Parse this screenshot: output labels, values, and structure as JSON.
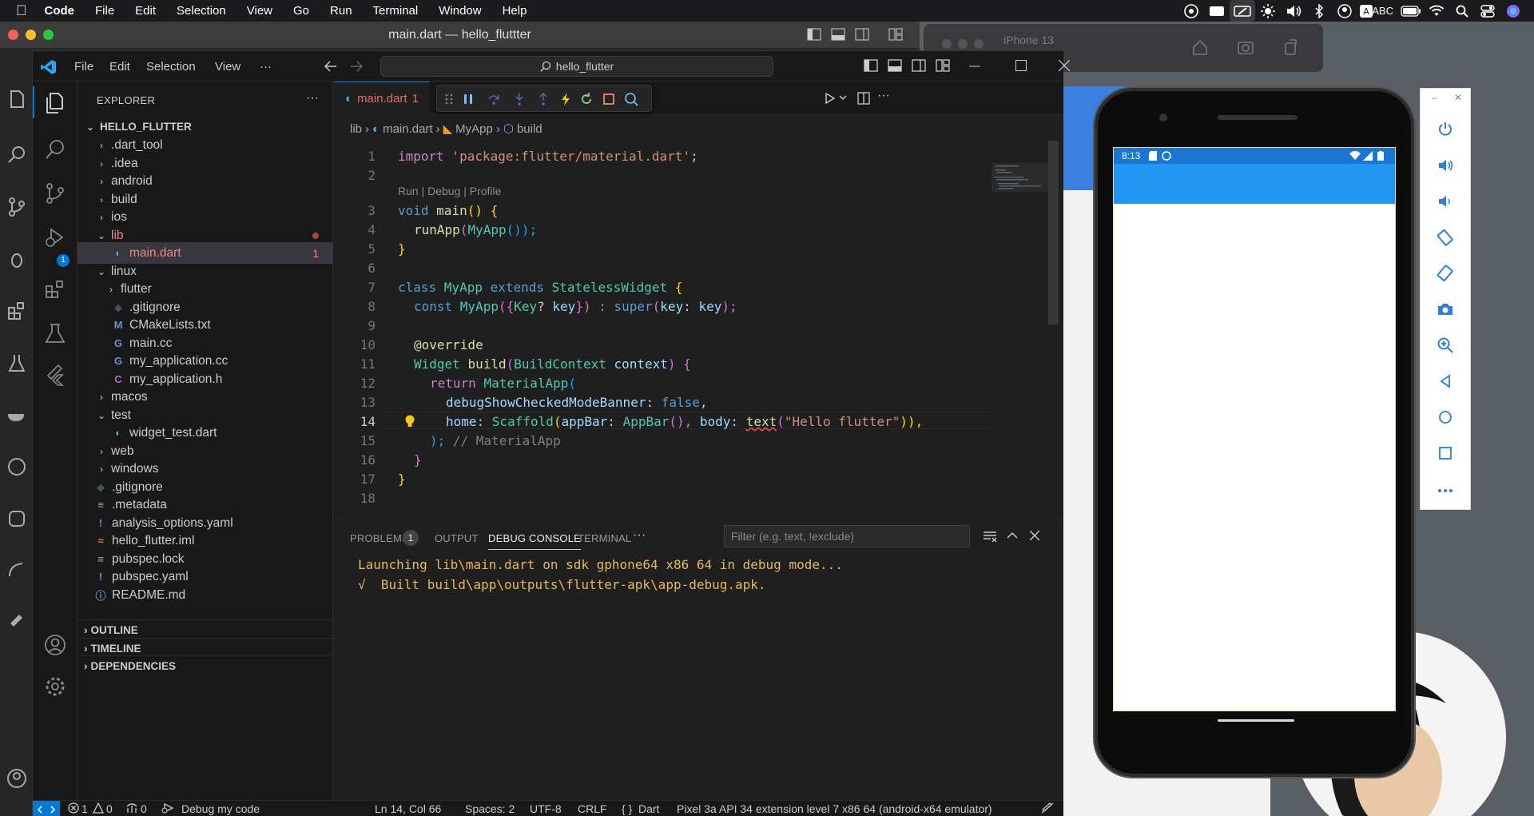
{
  "macbar": {
    "app": "Code",
    "menus": [
      "File",
      "Edit",
      "Selection",
      "View",
      "Go",
      "Run",
      "Terminal",
      "Window",
      "Help"
    ],
    "input_source": "ABC"
  },
  "outer_window": {
    "title": "main.dart — hello_fluttter"
  },
  "simulator": {
    "name": "iPhone 13"
  },
  "vscode": {
    "menus": [
      "File",
      "Edit",
      "Selection",
      "View",
      "···"
    ],
    "search": "hello_flutter",
    "explorer": {
      "title": "EXPLORER",
      "root": "HELLO_FLUTTER",
      "items": [
        {
          "label": ".dart_tool",
          "type": "folder"
        },
        {
          "label": ".idea",
          "type": "folder"
        },
        {
          "label": "android",
          "type": "folder"
        },
        {
          "label": "build",
          "type": "folder"
        },
        {
          "label": "ios",
          "type": "folder"
        },
        {
          "label": "lib",
          "type": "folder-open"
        },
        {
          "label": "main.dart",
          "type": "dart",
          "badge": "1"
        },
        {
          "label": "linux",
          "type": "folder-open"
        },
        {
          "label": "flutter",
          "type": "folder"
        },
        {
          "label": ".gitignore",
          "type": "git"
        },
        {
          "label": "CMakeLists.txt",
          "type": "cmake"
        },
        {
          "label": "main.cc",
          "type": "cpp"
        },
        {
          "label": "my_application.cc",
          "type": "cpp"
        },
        {
          "label": "my_application.h",
          "type": "h"
        },
        {
          "label": "macos",
          "type": "folder"
        },
        {
          "label": "test",
          "type": "folder-open"
        },
        {
          "label": "widget_test.dart",
          "type": "dart"
        },
        {
          "label": "web",
          "type": "folder"
        },
        {
          "label": "windows",
          "type": "folder"
        },
        {
          "label": ".gitignore",
          "type": "git"
        },
        {
          "label": ".metadata",
          "type": "lines"
        },
        {
          "label": "analysis_options.yaml",
          "type": "yaml"
        },
        {
          "label": "hello_flutter.iml",
          "type": "rss"
        },
        {
          "label": "pubspec.lock",
          "type": "lines"
        },
        {
          "label": "pubspec.yaml",
          "type": "yaml"
        },
        {
          "label": "README.md",
          "type": "info"
        }
      ],
      "sections": [
        "OUTLINE",
        "TIMELINE",
        "DEPENDENCIES"
      ]
    },
    "activity_badge": "1",
    "tab": {
      "label": "main.dart",
      "badge": "1"
    },
    "breadcrumb": [
      "lib",
      "main.dart",
      "MyApp",
      "build"
    ],
    "code_lens": "Run | Debug | Profile",
    "line_numbers": [
      "1",
      "2",
      "3",
      "4",
      "5",
      "6",
      "7",
      "8",
      "9",
      "10",
      "11",
      "12",
      "13",
      "14",
      "15",
      "16",
      "17",
      "18"
    ],
    "code_text": {
      "l1a": "import ",
      "l1b": "'package:flutter/material.dart'",
      "l1c": ";",
      "l3a": "void ",
      "l3b": "main",
      "l3c": "() {",
      "l4a": "runApp",
      "l4b": "(",
      "l4c": "MyApp",
      "l4d": "());",
      "l7a": "class ",
      "l7b": "MyApp ",
      "l7c": "extends ",
      "l7d": "StatelessWidget ",
      "l7e": "{",
      "l8a": "const ",
      "l8b": "MyApp",
      "l8c": "({",
      "l8d": "Key",
      "l8e": "? ",
      "l8f": "key",
      "l8g": "}) : ",
      "l8h": "super",
      "l8i": "(",
      "l8j": "key",
      "l8k": ": ",
      "l8l": "key",
      "l8m": ");",
      "l10": "@override",
      "l11a": "Widget ",
      "l11b": "build",
      "l11c": "(",
      "l11d": "BuildContext ",
      "l11e": "context",
      "l11f": ") {",
      "l12a": "return ",
      "l12b": "MaterialApp",
      "l12c": "(",
      "l13a": "debugShowCheckedModeBanner",
      "l13b": ": ",
      "l13c": "false",
      "l13d": ",",
      "l14a": "home",
      "l14b": ": ",
      "l14c": "Scaffold",
      "l14d": "(",
      "l14e": "appBar",
      "l14f": ": ",
      "l14g": "AppBar",
      "l14h": "(), ",
      "l14i": "body",
      "l14j": ": ",
      "l14k": "text",
      "l14l": "(",
      "l14m": "\"Hello flutter\"",
      "l14n": ")),",
      "l15a": "); ",
      "l15b": "// MaterialApp",
      "l16": "}",
      "l17": "}"
    },
    "panel": {
      "tabs": [
        "PROBLEMS",
        "OUTPUT",
        "DEBUG CONSOLE",
        "TERMINAL",
        "···"
      ],
      "problems_count": "1",
      "filter_placeholder": "Filter (e.g. text, !exclude)",
      "lines": [
        "Launching lib\\main.dart on sdk gphone64 x86 64 in debug mode...",
        "√  Built build\\app\\outputs\\flutter-apk\\app-debug.apk."
      ],
      "prompt": ">"
    },
    "status": {
      "errors": "1",
      "warnings": "0",
      "ports": "0",
      "debug": "Debug my code",
      "position": "Ln 14, Col 66",
      "spaces": "Spaces: 2",
      "encoding": "UTF-8",
      "eol": "CRLF",
      "language": "Dart",
      "device": "Pixel 3a API 34 extension level 7 x86 64 (android-x64 emulator)"
    }
  },
  "android": {
    "time": "8:13"
  },
  "emulator_controls": [
    "power-icon",
    "volume-up-icon",
    "volume-down-icon",
    "rotate-left-icon",
    "rotate-right-icon",
    "camera-icon",
    "zoom-icon",
    "back-icon",
    "home-icon",
    "overview-icon",
    "more-icon"
  ]
}
